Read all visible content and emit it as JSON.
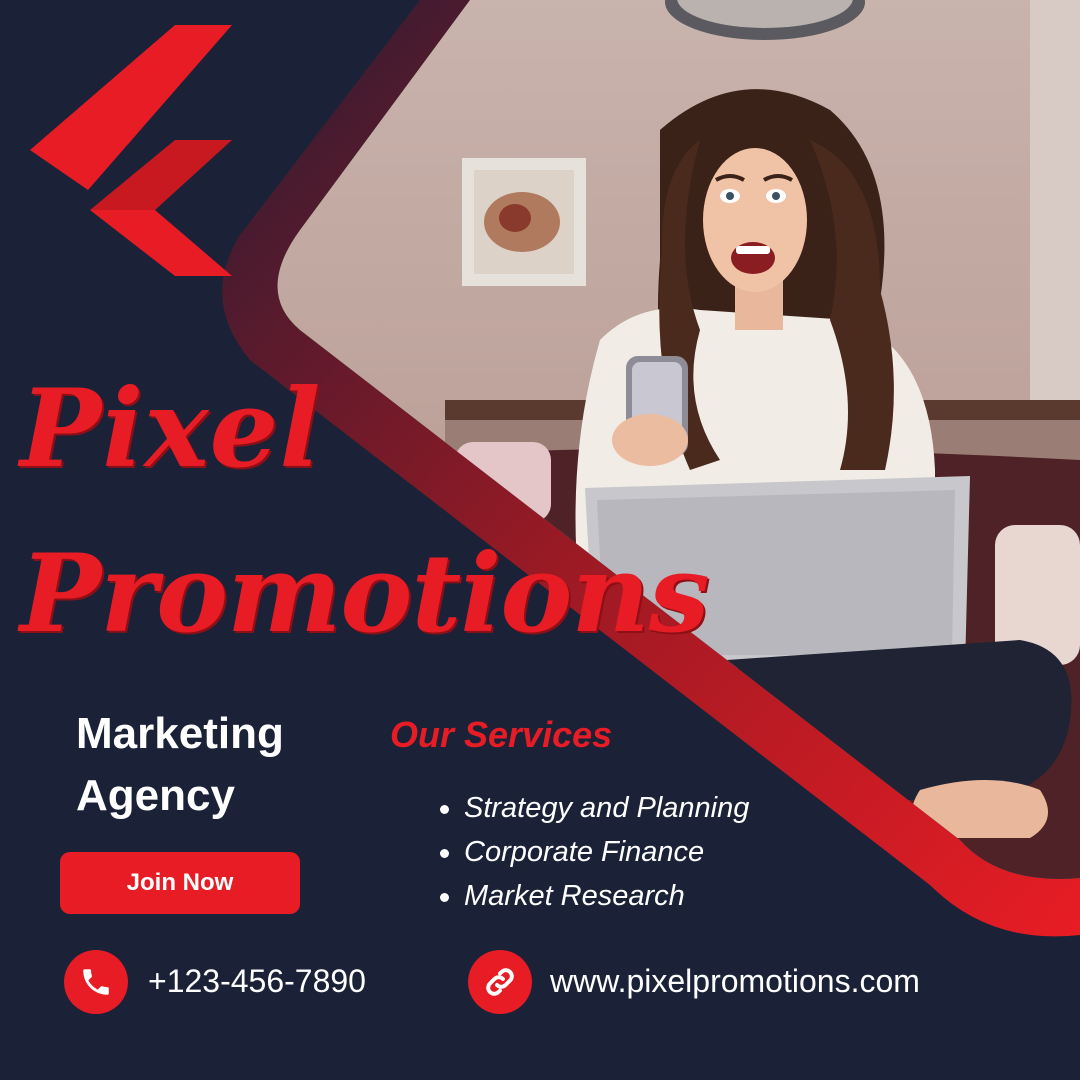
{
  "brand": {
    "title_line_1": "Pixel",
    "title_line_2": "Promotions",
    "tagline_line_1": "Marketing",
    "tagline_line_2": "Agency"
  },
  "cta": {
    "label": "Join Now"
  },
  "services": {
    "heading": "Our Services",
    "items": [
      "Strategy and Planning",
      "Corporate Finance",
      "Market Research"
    ]
  },
  "contact": {
    "phone": "+123-456-7890",
    "website": "www.pixelpromotions.com",
    "phone_icon": "phone-icon",
    "link_icon": "link-icon"
  },
  "colors": {
    "background": "#1b2238",
    "accent": "#e81c24",
    "text": "#ffffff"
  }
}
